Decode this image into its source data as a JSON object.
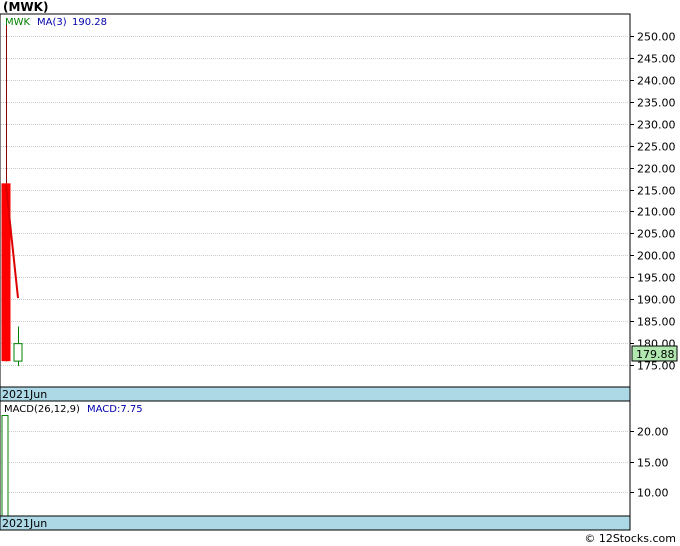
{
  "header": {
    "title": "(MWK)"
  },
  "footer": {
    "watermark": "© 12Stocks.com"
  },
  "colors": {
    "down_candle": "#ff0000",
    "up_candle": "#008000",
    "ma_line": "#dd0000",
    "date_bar": "#add8e6",
    "last_price_box": "#b0e8b0",
    "grid": "#999999",
    "legend_ticker": "#008000",
    "legend_indicator": "#0000aa"
  },
  "chart_data": [
    {
      "type": "candlestick",
      "legend": {
        "ticker": "MWK",
        "ma_label": "MA(3)",
        "ma_value": "190.28"
      },
      "ylim": [
        170,
        255
      ],
      "yticks": [
        175,
        180,
        185,
        190,
        195,
        200,
        205,
        210,
        215,
        220,
        225,
        230,
        235,
        240,
        245,
        250
      ],
      "ytick_labels": [
        "175.00",
        "180.00",
        "185.00",
        "190.00",
        "195.00",
        "200.00",
        "205.00",
        "210.00",
        "215.00",
        "220.00",
        "225.00",
        "230.00",
        "235.00",
        "240.00",
        "245.00",
        "250.00"
      ],
      "x_label": "2021Jun",
      "last_price": "179.88",
      "grid": true,
      "candles": [
        {
          "open": 216.3,
          "high": 252.5,
          "low": 175.8,
          "close": 176.0
        },
        {
          "open": 175.9,
          "high": 183.8,
          "low": 174.8,
          "close": 179.88
        }
      ],
      "ma": [
        216.0,
        190.28
      ]
    },
    {
      "type": "bar",
      "legend": {
        "label": "MACD(26,12,9)",
        "value_label": "MACD:7.75"
      },
      "ylim": [
        6,
        25
      ],
      "yticks": [
        10,
        15,
        20
      ],
      "ytick_labels": [
        "10.00",
        "15.00",
        "20.00"
      ],
      "x_label": "2021Jun",
      "grid": true,
      "values": [
        22.6
      ]
    }
  ]
}
